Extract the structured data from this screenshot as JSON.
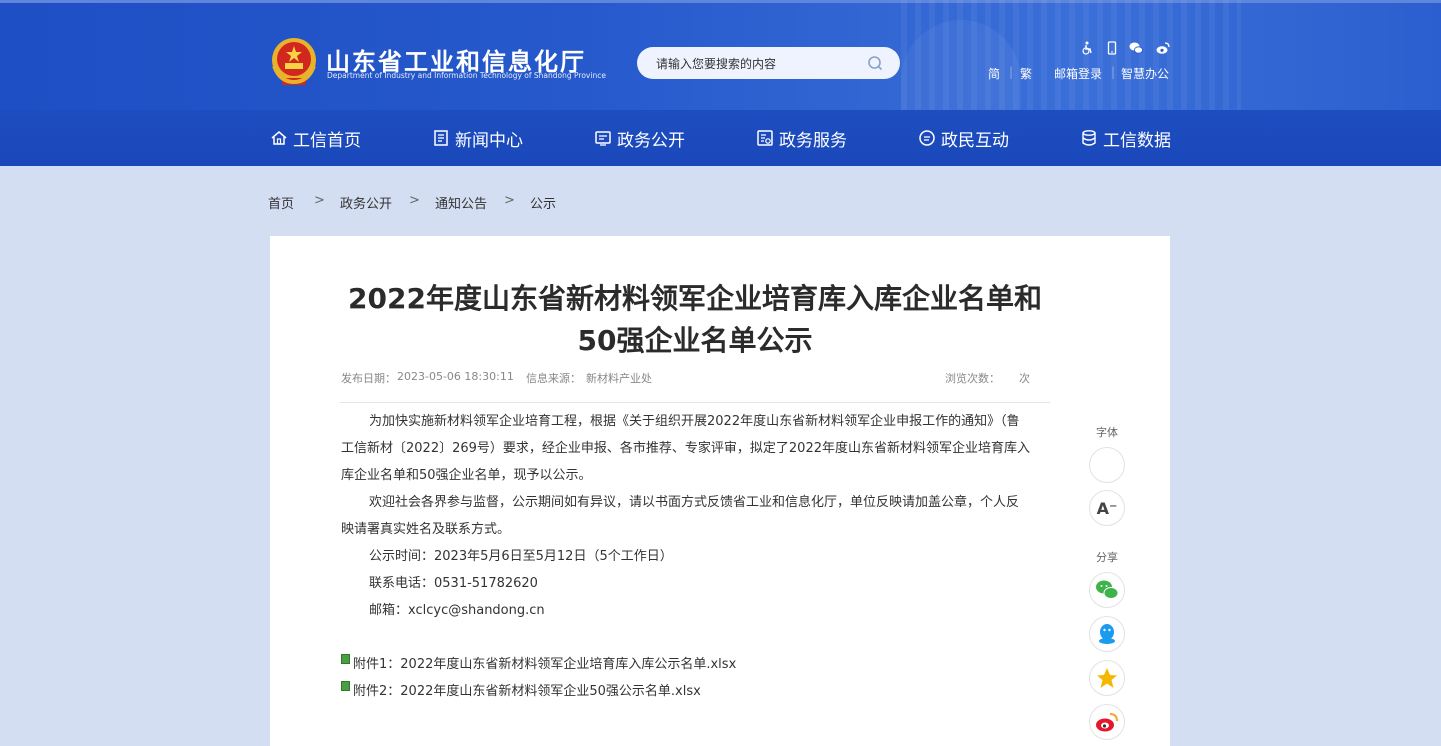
{
  "header": {
    "site_name": "山东省工业和信息化厅",
    "site_name_en": "Department of Industry and Information Technology of Shandong Province",
    "search_placeholder": "请输入您要搜索的内容",
    "accessibility_icons": [
      "wheelchair-icon",
      "mobile-icon",
      "wechat-icon",
      "weibo-icon"
    ],
    "top_links": [
      "简",
      "繁",
      "邮箱登录",
      "智慧办公"
    ]
  },
  "nav": [
    {
      "label": "工信首页",
      "icon": "home-icon"
    },
    {
      "label": "新闻中心",
      "icon": "news-icon"
    },
    {
      "label": "政务公开",
      "icon": "open-gov-icon"
    },
    {
      "label": "政务服务",
      "icon": "service-icon"
    },
    {
      "label": "政民互动",
      "icon": "chat-icon"
    },
    {
      "label": "工信数据",
      "icon": "database-icon"
    }
  ],
  "breadcrumb": [
    "首页",
    "政务公开",
    "通知公告",
    "公示"
  ],
  "breadcrumb_sep": ">",
  "article": {
    "title_line1": "2022年度山东省新材料领军企业培育库入库企业名单和",
    "title_line2": "50强企业名单公示",
    "meta": {
      "date_label": "发布日期：",
      "date": "2023-05-06 18:30:11",
      "source_label": "信息来源：",
      "source": "新材料产业处",
      "views_label": "浏览次数：",
      "views_unit": "次"
    },
    "para1_line1": "为加快实施新材料领军企业培育工程，根据《关于组织开展2022年度山东省新材料领军企业申报工作的通知》（鲁",
    "para1_line2": "工信新材〔2022〕269号）要求，经企业申报、各市推荐、专家评审，拟定了2022年度山东省新材料领军企业培育库入",
    "para1_line3": "库企业名单和50强企业名单，现予以公示。",
    "para2_line1": "欢迎社会各界参与监督，公示期间如有异议，请以书面方式反馈省工业和信息化厅，单位反映请加盖公章，个人反",
    "para2_line2": "映请署真实姓名及联系方式。",
    "time": "公示时间：2023年5月6日至5月12日（5个工作日）",
    "phone": "联系电话：0531-51782620",
    "email": "邮箱：xclcyc@shandong.cn",
    "attachments": [
      "附件1：2022年度山东省新材料领军企业培育库入库公示名单.xlsx",
      "附件2：2022年度山东省新材料领军企业50强公示名单.xlsx"
    ]
  },
  "side_tools": {
    "font_label": "字体",
    "font_decrease": "A⁻",
    "share_label": "分享",
    "share_icons": [
      "wechat-share-icon",
      "qq-share-icon",
      "qzone-share-icon",
      "weibo-share-icon"
    ]
  },
  "colors": {
    "header_blue": "#1f4fc2",
    "page_bg": "#d3def3",
    "wechat_green": "#3db34a",
    "qq_blue": "#1b9bf0",
    "qzone_yellow": "#f5b800",
    "weibo_red": "#e6162d"
  }
}
